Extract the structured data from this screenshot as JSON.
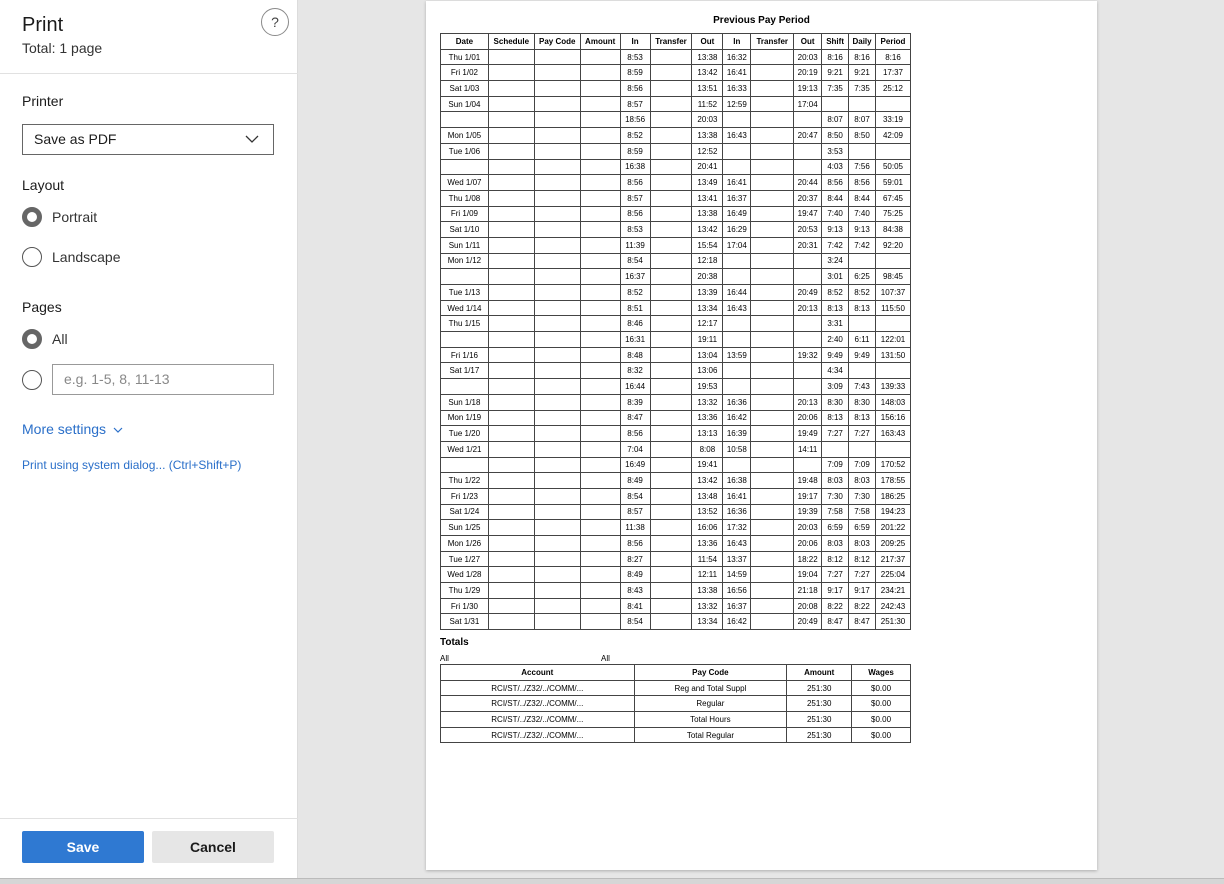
{
  "panel": {
    "title": "Print",
    "subtitle": "Total: 1 page",
    "help": "?",
    "printer_label": "Printer",
    "printer_value": "Save as PDF",
    "layout_label": "Layout",
    "layout_portrait": "Portrait",
    "layout_landscape": "Landscape",
    "pages_label": "Pages",
    "pages_all": "All",
    "pages_placeholder": "e.g. 1-5, 8, 11-13",
    "more_settings": "More settings",
    "system_dialog": "Print using system dialog... (Ctrl+Shift+P)",
    "save": "Save",
    "cancel": "Cancel"
  },
  "report": {
    "title": "Previous Pay Period",
    "headers": [
      "Date",
      "Schedule",
      "Pay Code",
      "Amount",
      "In",
      "Transfer",
      "Out",
      "In",
      "Transfer",
      "Out",
      "Shift",
      "Daily",
      "Period"
    ],
    "rows": [
      [
        "Thu 1/01",
        "",
        "",
        "",
        "8:53",
        "",
        "13:38",
        "16:32",
        "",
        "20:03",
        "8:16",
        "8:16",
        "8:16"
      ],
      [
        "Fri 1/02",
        "",
        "",
        "",
        "8:59",
        "",
        "13:42",
        "16:41",
        "",
        "20:19",
        "9:21",
        "9:21",
        "17:37"
      ],
      [
        "Sat 1/03",
        "",
        "",
        "",
        "8:56",
        "",
        "13:51",
        "16:33",
        "",
        "19:13",
        "7:35",
        "7:35",
        "25:12"
      ],
      [
        "Sun 1/04",
        "",
        "",
        "",
        "8:57",
        "",
        "11:52",
        "12:59",
        "",
        "17:04",
        "",
        "",
        ""
      ],
      [
        "",
        "",
        "",
        "",
        "18:56",
        "",
        "20:03",
        "",
        "",
        "",
        "8:07",
        "8:07",
        "33:19"
      ],
      [
        "Mon 1/05",
        "",
        "",
        "",
        "8:52",
        "",
        "13:38",
        "16:43",
        "",
        "20:47",
        "8:50",
        "8:50",
        "42:09"
      ],
      [
        "Tue 1/06",
        "",
        "",
        "",
        "8:59",
        "",
        "12:52",
        "",
        "",
        "",
        "3:53",
        "",
        ""
      ],
      [
        "",
        "",
        "",
        "",
        "16:38",
        "",
        "20:41",
        "",
        "",
        "",
        "4:03",
        "7:56",
        "50:05"
      ],
      [
        "Wed 1/07",
        "",
        "",
        "",
        "8:56",
        "",
        "13:49",
        "16:41",
        "",
        "20:44",
        "8:56",
        "8:56",
        "59:01"
      ],
      [
        "Thu 1/08",
        "",
        "",
        "",
        "8:57",
        "",
        "13:41",
        "16:37",
        "",
        "20:37",
        "8:44",
        "8:44",
        "67:45"
      ],
      [
        "Fri 1/09",
        "",
        "",
        "",
        "8:56",
        "",
        "13:38",
        "16:49",
        "",
        "19:47",
        "7:40",
        "7:40",
        "75:25"
      ],
      [
        "Sat 1/10",
        "",
        "",
        "",
        "8:53",
        "",
        "13:42",
        "16:29",
        "",
        "20:53",
        "9:13",
        "9:13",
        "84:38"
      ],
      [
        "Sun 1/11",
        "",
        "",
        "",
        "11:39",
        "",
        "15:54",
        "17:04",
        "",
        "20:31",
        "7:42",
        "7:42",
        "92:20"
      ],
      [
        "Mon 1/12",
        "",
        "",
        "",
        "8:54",
        "",
        "12:18",
        "",
        "",
        "",
        "3:24",
        "",
        ""
      ],
      [
        "",
        "",
        "",
        "",
        "16:37",
        "",
        "20:38",
        "",
        "",
        "",
        "3:01",
        "6:25",
        "98:45"
      ],
      [
        "Tue 1/13",
        "",
        "",
        "",
        "8:52",
        "",
        "13:39",
        "16:44",
        "",
        "20:49",
        "8:52",
        "8:52",
        "107:37"
      ],
      [
        "Wed 1/14",
        "",
        "",
        "",
        "8:51",
        "",
        "13:34",
        "16:43",
        "",
        "20:13",
        "8:13",
        "8:13",
        "115:50"
      ],
      [
        "Thu 1/15",
        "",
        "",
        "",
        "8:46",
        "",
        "12:17",
        "",
        "",
        "",
        "3:31",
        "",
        ""
      ],
      [
        "",
        "",
        "",
        "",
        "16:31",
        "",
        "19:11",
        "",
        "",
        "",
        "2:40",
        "6:11",
        "122:01"
      ],
      [
        "Fri 1/16",
        "",
        "",
        "",
        "8:48",
        "",
        "13:04",
        "13:59",
        "",
        "19:32",
        "9:49",
        "9:49",
        "131:50"
      ],
      [
        "Sat 1/17",
        "",
        "",
        "",
        "8:32",
        "",
        "13:06",
        "",
        "",
        "",
        "4:34",
        "",
        ""
      ],
      [
        "",
        "",
        "",
        "",
        "16:44",
        "",
        "19:53",
        "",
        "",
        "",
        "3:09",
        "7:43",
        "139:33"
      ],
      [
        "Sun 1/18",
        "",
        "",
        "",
        "8:39",
        "",
        "13:32",
        "16:36",
        "",
        "20:13",
        "8:30",
        "8:30",
        "148:03"
      ],
      [
        "Mon 1/19",
        "",
        "",
        "",
        "8:47",
        "",
        "13:36",
        "16:42",
        "",
        "20:06",
        "8:13",
        "8:13",
        "156:16"
      ],
      [
        "Tue 1/20",
        "",
        "",
        "",
        "8:56",
        "",
        "13:13",
        "16:39",
        "",
        "19:49",
        "7:27",
        "7:27",
        "163:43"
      ],
      [
        "Wed 1/21",
        "",
        "",
        "",
        "7:04",
        "",
        "8:08",
        "10:58",
        "",
        "14:11",
        "",
        "",
        ""
      ],
      [
        "",
        "",
        "",
        "",
        "16:49",
        "",
        "19:41",
        "",
        "",
        "",
        "7:09",
        "7:09",
        "170:52"
      ],
      [
        "Thu 1/22",
        "",
        "",
        "",
        "8:49",
        "",
        "13:42",
        "16:38",
        "",
        "19:48",
        "8:03",
        "8:03",
        "178:55"
      ],
      [
        "Fri 1/23",
        "",
        "",
        "",
        "8:54",
        "",
        "13:48",
        "16:41",
        "",
        "19:17",
        "7:30",
        "7:30",
        "186:25"
      ],
      [
        "Sat 1/24",
        "",
        "",
        "",
        "8:57",
        "",
        "13:52",
        "16:36",
        "",
        "19:39",
        "7:58",
        "7:58",
        "194:23"
      ],
      [
        "Sun 1/25",
        "",
        "",
        "",
        "11:38",
        "",
        "16:06",
        "17:32",
        "",
        "20:03",
        "6:59",
        "6:59",
        "201:22"
      ],
      [
        "Mon 1/26",
        "",
        "",
        "",
        "8:56",
        "",
        "13:36",
        "16:43",
        "",
        "20:06",
        "8:03",
        "8:03",
        "209:25"
      ],
      [
        "Tue 1/27",
        "",
        "",
        "",
        "8:27",
        "",
        "11:54",
        "13:37",
        "",
        "18:22",
        "8:12",
        "8:12",
        "217:37"
      ],
      [
        "Wed 1/28",
        "",
        "",
        "",
        "8:49",
        "",
        "12:11",
        "14:59",
        "",
        "19:04",
        "7:27",
        "7:27",
        "225:04"
      ],
      [
        "Thu 1/29",
        "",
        "",
        "",
        "8:43",
        "",
        "13:38",
        "16:56",
        "",
        "21:18",
        "9:17",
        "9:17",
        "234:21"
      ],
      [
        "Fri 1/30",
        "",
        "",
        "",
        "8:41",
        "",
        "13:32",
        "16:37",
        "",
        "20:08",
        "8:22",
        "8:22",
        "242:43"
      ],
      [
        "Sat 1/31",
        "",
        "",
        "",
        "8:54",
        "",
        "13:34",
        "16:42",
        "",
        "20:49",
        "8:47",
        "8:47",
        "251:30"
      ]
    ],
    "totals_label": "Totals",
    "all_left": "All",
    "all_right": "All",
    "totals_headers": [
      "Account",
      "Pay Code",
      "Amount",
      "Wages"
    ],
    "totals_rows": [
      [
        "RCI/ST/../Z32/../COMM/...",
        "Reg and Total Suppl",
        "251:30",
        "$0.00"
      ],
      [
        "RCI/ST/../Z32/../COMM/...",
        "Regular",
        "251:30",
        "$0.00"
      ],
      [
        "RCI/ST/../Z32/../COMM/...",
        "Total Hours",
        "251:30",
        "$0.00"
      ],
      [
        "RCI/ST/../Z32/../COMM/...",
        "Total Regular",
        "251:30",
        "$0.00"
      ]
    ]
  }
}
